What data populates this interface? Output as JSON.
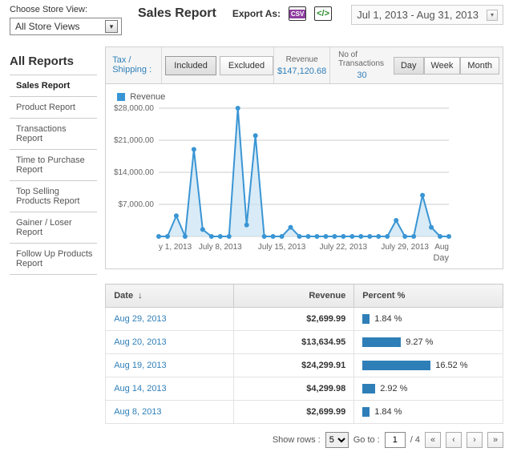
{
  "header": {
    "store_view_label": "Choose Store View:",
    "store_view_value": "All Store Views",
    "title": "Sales Report",
    "export_label": "Export As:",
    "date_range": "Jul 1, 2013 - Aug 31, 2013"
  },
  "sidebar": {
    "heading": "All Reports",
    "items": [
      {
        "label": "Sales Report",
        "active": true
      },
      {
        "label": "Product Report",
        "active": false
      },
      {
        "label": "Transactions Report",
        "active": false
      },
      {
        "label": "Time to Purchase Report",
        "active": false
      },
      {
        "label": "Top Selling Products Report",
        "active": false
      },
      {
        "label": "Gainer / Loser Report",
        "active": false
      },
      {
        "label": "Follow Up Products Report",
        "active": false
      }
    ]
  },
  "toolbar": {
    "tax_label": "Tax / Shipping :",
    "included": "Included",
    "excluded": "Excluded",
    "revenue_label": "Revenue",
    "revenue_value": "$147,120.68",
    "trans_label": "No of Transactions",
    "trans_value": "30",
    "seg_day": "Day",
    "seg_week": "Week",
    "seg_month": "Month"
  },
  "legend": {
    "revenue": "Revenue"
  },
  "axes": {
    "x_title": "Day"
  },
  "table": {
    "cols": {
      "date": "Date",
      "revenue": "Revenue",
      "percent": "Percent %"
    },
    "rows": [
      {
        "date": "Aug 29, 2013",
        "revenue": "$2,699.99",
        "percent": "1.84 %",
        "bar": 9
      },
      {
        "date": "Aug 20, 2013",
        "revenue": "$13,634.95",
        "percent": "9.27 %",
        "bar": 48
      },
      {
        "date": "Aug 19, 2013",
        "revenue": "$24,299.91",
        "percent": "16.52 %",
        "bar": 85
      },
      {
        "date": "Aug 14, 2013",
        "revenue": "$4,299.98",
        "percent": "2.92 %",
        "bar": 16
      },
      {
        "date": "Aug 8, 2013",
        "revenue": "$2,699.99",
        "percent": "1.84 %",
        "bar": 9
      }
    ]
  },
  "pager": {
    "show_rows": "Show rows :",
    "rows_value": "5",
    "goto": "Go to :",
    "goto_value": "1",
    "total": "/ 4"
  },
  "chart_data": {
    "type": "line",
    "title": "Revenue",
    "xlabel": "Day",
    "ylabel": "",
    "ylim": [
      0,
      28000
    ],
    "y_ticks": [
      "$7,000.00",
      "$14,000.00",
      "$21,000.00",
      "$28,000.00"
    ],
    "x_tick_labels": [
      "y 1, 2013",
      "July 8, 2013",
      "July 15, 2013",
      "July 22, 2013",
      "July 29, 2013",
      "Aug"
    ],
    "x": [
      "2013-07-01",
      "2013-07-02",
      "2013-07-03",
      "2013-07-04",
      "2013-07-05",
      "2013-07-06",
      "2013-07-07",
      "2013-07-08",
      "2013-07-09",
      "2013-07-10",
      "2013-07-11",
      "2013-07-12",
      "2013-07-13",
      "2013-07-14",
      "2013-07-15",
      "2013-07-16",
      "2013-07-17",
      "2013-07-18",
      "2013-07-19",
      "2013-07-20",
      "2013-07-21",
      "2013-07-22",
      "2013-07-23",
      "2013-07-24",
      "2013-07-25",
      "2013-07-26",
      "2013-07-27",
      "2013-07-28",
      "2013-07-29",
      "2013-07-30",
      "2013-07-31",
      "2013-08-01",
      "2013-08-02",
      "2013-08-03"
    ],
    "series": [
      {
        "name": "Revenue",
        "values": [
          0,
          0,
          4500,
          0,
          19000,
          1500,
          0,
          0,
          0,
          28000,
          2500,
          22000,
          0,
          0,
          0,
          2000,
          0,
          0,
          0,
          0,
          0,
          0,
          0,
          0,
          0,
          0,
          0,
          3500,
          0,
          0,
          9000,
          2000,
          0,
          0
        ]
      }
    ]
  }
}
